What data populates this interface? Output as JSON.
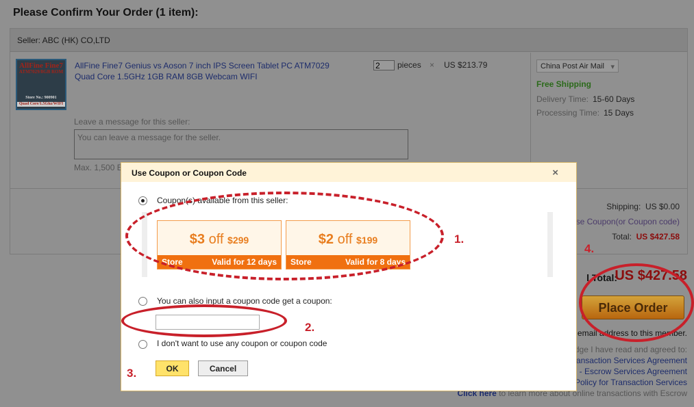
{
  "page": {
    "title": "Please Confirm Your Order (1 item):"
  },
  "seller": {
    "label": "Seller: ABC (HK) CO,LTD"
  },
  "product": {
    "thumb_lines": [
      "AllFine Fine7",
      "ATM7029/8GB ROM",
      "Store No.: 900901",
      "Quad Core/1.5Ghz/WIFI"
    ],
    "name": "AllFine Fine7 Genius vs Aoson 7 inch IPS Screen Tablet PC ATM7029 Quad Core 1.5GHz 1GB RAM 8GB Webcam WIFI",
    "quantity": "2",
    "unit": "pieces",
    "times": "×",
    "price": "US $213.79",
    "message_label": "Leave a message for this seller:",
    "message_placeholder": "You can leave a message for the seller.",
    "max_note": "Max. 1,500 E"
  },
  "shipping": {
    "method": "China Post Air Mail",
    "free": "Free Shipping",
    "delivery_label": "Delivery Time:",
    "delivery": "15-60 Days",
    "processing_label": "Processing Time:",
    "processing": "15 Days"
  },
  "summary": {
    "shipping_label": "Shipping:",
    "shipping_value": "US $0.00",
    "coupon_link": "se Coupon(or Coupon code)",
    "total_label": "Total:",
    "total_value": "US $427.58",
    "grand_label": "l Total:",
    "grand_value": "US $427.58",
    "place_order": "Place Order",
    "email_note": "email address to this member.",
    "agree": "dge I have read and agreed to:",
    "links": [
      "ansaction Services Agreement",
      "- Escrow Services Agreement",
      "Policy for Transaction Services"
    ],
    "click_here": "Click here",
    "escrow_note": " to learn more about online transactions with Escrow"
  },
  "modal": {
    "title": "Use Coupon or Coupon Code",
    "close": "×",
    "option1": "Coupon(s) available from this seller:",
    "coupons": [
      {
        "amount": "$3",
        "off": "off",
        "min": "$299",
        "type": "Store",
        "validity": "Valid for 12 days"
      },
      {
        "amount": "$2",
        "off": "off",
        "min": "$199",
        "type": "Store",
        "validity": "Valid for 8 days"
      }
    ],
    "option2": "You can also input a coupon code get a coupon:",
    "code_value": "",
    "option3": "I don't want to use any coupon or coupon code",
    "ok": "OK",
    "cancel": "Cancel"
  },
  "annotations": [
    "1.",
    "2.",
    "3.",
    "4."
  ],
  "colors": {
    "annotation": "#c8202a",
    "coupon_orange": "#f07010",
    "total_red": "#8b0d0d",
    "free_green": "#2b6a1a"
  }
}
